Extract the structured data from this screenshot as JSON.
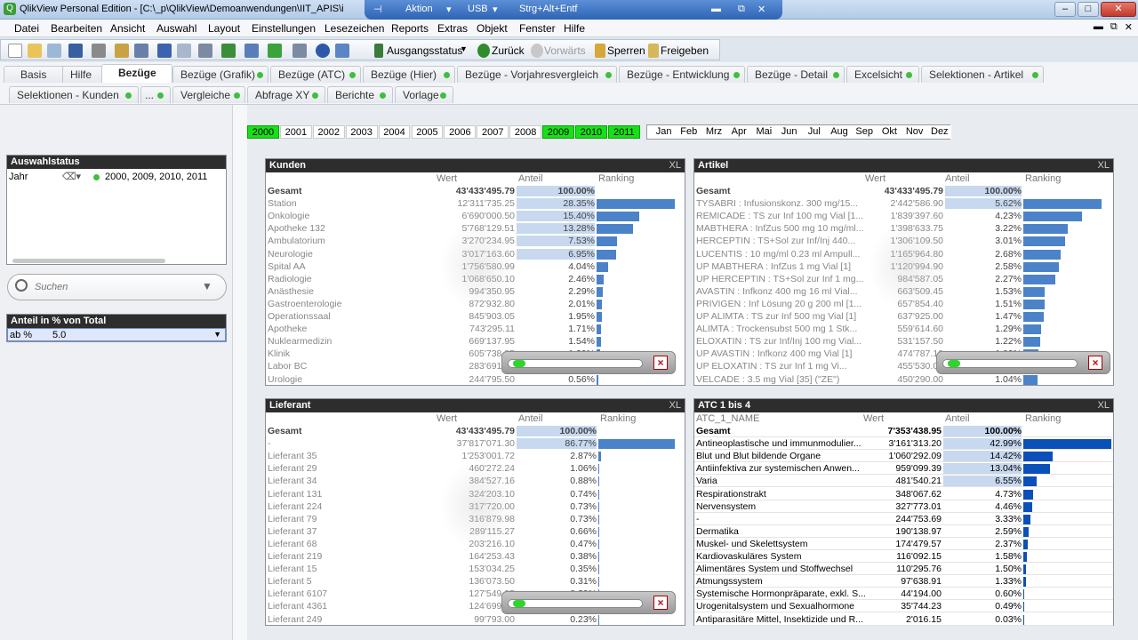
{
  "window": {
    "title": "QlikView Personal Edition - [C:\\_p\\QlikView\\Demoanwendungen\\IIT_APIS\\i"
  },
  "vm_bar": {
    "aktion": "Aktion",
    "usb": "USB",
    "keys": "Strg+Alt+Entf"
  },
  "menu": [
    "Datei",
    "Bearbeiten",
    "Ansicht",
    "Auswahl",
    "Layout",
    "Einstellungen",
    "Lesezeichen",
    "Reports",
    "Extras",
    "Objekt",
    "Fenster",
    "Hilfe"
  ],
  "toolbar": {
    "ausgangsstatus": "Ausgangsstatus",
    "zurueck": "Zurück",
    "vorwaerts": "Vorwärts",
    "sperren": "Sperren",
    "freigeben": "Freigeben"
  },
  "tabs_row1": [
    "Basis",
    "Hilfe",
    "Bezüge",
    "Bezüge (Grafik)",
    "Bezüge (ATC)",
    "Bezüge (Hier)",
    "Bezüge - Vorjahresvergleich",
    "Bezüge - Entwicklung",
    "Bezüge - Detail",
    "Excelsicht",
    "Selektionen - Artikel"
  ],
  "tabs_row2": [
    "Selektionen - Kunden",
    "...",
    "Vergleiche",
    "Abfrage XY",
    "Berichte",
    "Vorlage"
  ],
  "years": [
    "2000",
    "2001",
    "2002",
    "2003",
    "2004",
    "2005",
    "2006",
    "2007",
    "2008",
    "2009",
    "2010",
    "2011"
  ],
  "selected_years": [
    "2000",
    "2009",
    "2010",
    "2011"
  ],
  "months": [
    "Jan",
    "Feb",
    "Mrz",
    "Apr",
    "Mai",
    "Jun",
    "Jul",
    "Aug",
    "Sep",
    "Okt",
    "Nov",
    "Dez"
  ],
  "auswahlstatus": {
    "title": "Auswahlstatus",
    "field": "Jahr",
    "value": "2000, 2009, 2010, 2011"
  },
  "search": {
    "placeholder": "Suchen"
  },
  "anteil": {
    "title": "Anteil in % von Total",
    "label": "ab %",
    "value": "5.0"
  },
  "colors": {
    "accent": "#4b82c8",
    "selected": "#18e018",
    "header": "#2d2d2d"
  },
  "kunden": {
    "title": "Kunden",
    "xl": "XL",
    "headers": {
      "name": "",
      "wert": "Wert",
      "anteil": "Anteil",
      "ranking": "Ranking"
    },
    "total": {
      "name": "Gesamt",
      "wert": "43'433'495.79",
      "anteil": "100.00%"
    },
    "rows": [
      {
        "name": "Station",
        "wert": "12'311'735.25",
        "anteil": "28.35%",
        "r": 28.35,
        "sel": true
      },
      {
        "name": "Onkologie",
        "wert": "6'690'000.50",
        "anteil": "15.40%",
        "r": 15.4,
        "sel": true
      },
      {
        "name": "Apotheke 132",
        "wert": "5'768'129.51",
        "anteil": "13.28%",
        "r": 13.28,
        "sel": true
      },
      {
        "name": "Ambulatorium",
        "wert": "3'270'234.95",
        "anteil": "7.53%",
        "r": 7.53,
        "sel": true
      },
      {
        "name": "Neurologie",
        "wert": "3'017'163.60",
        "anteil": "6.95%",
        "r": 6.95,
        "sel": true
      },
      {
        "name": "Spital AA",
        "wert": "1'756'580.99",
        "anteil": "4.04%",
        "r": 4.04
      },
      {
        "name": "Radiologie",
        "wert": "1'068'650.10",
        "anteil": "2.46%",
        "r": 2.46
      },
      {
        "name": "Anästhesie",
        "wert": "994'350.95",
        "anteil": "2.29%",
        "r": 2.29
      },
      {
        "name": "Gastroenterologie",
        "wert": "872'932.80",
        "anteil": "2.01%",
        "r": 2.01
      },
      {
        "name": "Operationssaal",
        "wert": "845'903.05",
        "anteil": "1.95%",
        "r": 1.95
      },
      {
        "name": "Apotheke",
        "wert": "743'295.11",
        "anteil": "1.71%",
        "r": 1.71
      },
      {
        "name": "Nuklearmedizin",
        "wert": "669'137.95",
        "anteil": "1.54%",
        "r": 1.54
      },
      {
        "name": "Klinik",
        "wert": "605'738.85",
        "anteil": "1.39%",
        "r": 1.39
      },
      {
        "name": "Labor BC",
        "wert": "283'691.23",
        "anteil": "0.65%",
        "r": 0.65
      },
      {
        "name": "Urologie",
        "wert": "244'795.50",
        "anteil": "0.56%",
        "r": 0.56
      }
    ]
  },
  "artikel": {
    "title": "Artikel",
    "xl": "XL",
    "headers": {
      "name": "",
      "wert": "Wert",
      "anteil": "Anteil",
      "ranking": "Ranking"
    },
    "total": {
      "name": "Gesamt",
      "wert": "43'433'495.79",
      "anteil": "100.00%"
    },
    "rows": [
      {
        "name": "TYSABRI : Infusionskonz.  300 mg/15...",
        "wert": "2'442'586.90",
        "anteil": "5.62%",
        "r": 5.62,
        "sel": true
      },
      {
        "name": "REMICADE : TS zur Inf 100 mg Vial [1...",
        "wert": "1'839'397.60",
        "anteil": "4.23%",
        "r": 4.23
      },
      {
        "name": "MABTHERA : InfZus 500 mg 10 mg/ml...",
        "wert": "1'398'633.75",
        "anteil": "3.22%",
        "r": 3.22
      },
      {
        "name": "HERCEPTIN : TS+Sol zur Inf/Inj 440...",
        "wert": "1'306'109.50",
        "anteil": "3.01%",
        "r": 3.01
      },
      {
        "name": "LUCENTIS :  10 mg/ml 0.23 ml Ampull...",
        "wert": "1'165'964.80",
        "anteil": "2.68%",
        "r": 2.68
      },
      {
        "name": "UP MABTHERA : InfZus 1 mg Vial [1]",
        "wert": "1'120'994.90",
        "anteil": "2.58%",
        "r": 2.58
      },
      {
        "name": "UP HERCEPTIN : TS+Sol zur Inf 1 mg...",
        "wert": "984'587.05",
        "anteil": "2.27%",
        "r": 2.27
      },
      {
        "name": "AVASTIN :  Infkonz 400 mg 16 ml Vial...",
        "wert": "663'509.45",
        "anteil": "1.53%",
        "r": 1.53
      },
      {
        "name": "PRIVIGEN : Inf Lösung 20 g 200 ml [1...",
        "wert": "657'854.40",
        "anteil": "1.51%",
        "r": 1.51
      },
      {
        "name": "UP ALIMTA : TS zur Inf 500 mg Vial [1]",
        "wert": "637'925.00",
        "anteil": "1.47%",
        "r": 1.47
      },
      {
        "name": "ALIMTA : Trockensubst  500 mg 1 Stk...",
        "wert": "559'614.60",
        "anteil": "1.29%",
        "r": 1.29
      },
      {
        "name": "ELOXATIN : TS zur Inf/Inj 100 mg Vial...",
        "wert": "531'157.50",
        "anteil": "1.22%",
        "r": 1.22
      },
      {
        "name": "UP AVASTIN : Infkonz  400 mg Vial [1]",
        "wert": "474'787.10",
        "anteil": "1.09%",
        "r": 1.09
      },
      {
        "name": "UP ELOXATIN : TS zur Inf 1 mg Vi...",
        "wert": "455'530.00",
        "anteil": "1.05%",
        "r": 1.05
      },
      {
        "name": "VELCADE : 3.5 mg Vial [35] (\"ZE\")",
        "wert": "450'290.00",
        "anteil": "1.04%",
        "r": 1.04
      }
    ]
  },
  "lieferant": {
    "title": "Lieferant",
    "xl": "XL",
    "headers": {
      "name": "",
      "wert": "Wert",
      "anteil": "Anteil",
      "ranking": "Ranking"
    },
    "total": {
      "name": "Gesamt",
      "wert": "43'433'495.79",
      "anteil": "100.00%"
    },
    "rows": [
      {
        "name": "-",
        "wert": "37'817'071.30",
        "anteil": "86.77%",
        "r": 86.77,
        "sel": true
      },
      {
        "name": "Lieferant 35",
        "wert": "1'253'001.72",
        "anteil": "2.87%",
        "r": 2.87
      },
      {
        "name": "Lieferant 29",
        "wert": "460'272.24",
        "anteil": "1.06%",
        "r": 1.06
      },
      {
        "name": "Lieferant 34",
        "wert": "384'527.16",
        "anteil": "0.88%",
        "r": 0.88
      },
      {
        "name": "Lieferant 131",
        "wert": "324'203.10",
        "anteil": "0.74%",
        "r": 0.74
      },
      {
        "name": "Lieferant 224",
        "wert": "317'720.00",
        "anteil": "0.73%",
        "r": 0.73
      },
      {
        "name": "Lieferant 79",
        "wert": "316'879.98",
        "anteil": "0.73%",
        "r": 0.73
      },
      {
        "name": "Lieferant 37",
        "wert": "289'115.27",
        "anteil": "0.66%",
        "r": 0.66
      },
      {
        "name": "Lieferant 68",
        "wert": "203'216.10",
        "anteil": "0.47%",
        "r": 0.47
      },
      {
        "name": "Lieferant 219",
        "wert": "164'253.43",
        "anteil": "0.38%",
        "r": 0.38
      },
      {
        "name": "Lieferant 15",
        "wert": "153'034.25",
        "anteil": "0.35%",
        "r": 0.35
      },
      {
        "name": "Lieferant 5",
        "wert": "136'073.50",
        "anteil": "0.31%",
        "r": 0.31
      },
      {
        "name": "Lieferant 6107",
        "wert": "127'549.95",
        "anteil": "0.29%",
        "r": 0.29
      },
      {
        "name": "Lieferant 4361",
        "wert": "124'699.50",
        "anteil": "0.29%",
        "r": 0.29
      },
      {
        "name": "Lieferant 249",
        "wert": "99'793.00",
        "anteil": "0.23%",
        "r": 0.23
      }
    ]
  },
  "atc": {
    "title": "ATC 1 bis 4",
    "xl": "XL",
    "headers": {
      "name": "ATC_1_NAME",
      "wert": "Wert",
      "anteil": "Anteil",
      "ranking": "Ranking"
    },
    "total": {
      "name": "Gesamt",
      "wert": "7'353'438.95",
      "anteil": "100.00%"
    },
    "rows": [
      {
        "name": "Antineoplastische und immunmodulier...",
        "wert": "3'161'313.20",
        "anteil": "42.99%",
        "r": 42.99,
        "sel": true
      },
      {
        "name": "Blut und Blut bildende Organe",
        "wert": "1'060'292.09",
        "anteil": "14.42%",
        "r": 14.42,
        "sel": true
      },
      {
        "name": "Antiinfektiva zur systemischen Anwen...",
        "wert": "959'099.39",
        "anteil": "13.04%",
        "r": 13.04,
        "sel": true
      },
      {
        "name": "Varia",
        "wert": "481'540.21",
        "anteil": "6.55%",
        "r": 6.55,
        "sel": true
      },
      {
        "name": "Respirationstrakt",
        "wert": "348'067.62",
        "anteil": "4.73%",
        "r": 4.73
      },
      {
        "name": "Nervensystem",
        "wert": "327'773.01",
        "anteil": "4.46%",
        "r": 4.46
      },
      {
        "name": "-",
        "wert": "244'753.69",
        "anteil": "3.33%",
        "r": 3.33
      },
      {
        "name": "Dermatika",
        "wert": "190'138.97",
        "anteil": "2.59%",
        "r": 2.59
      },
      {
        "name": "Muskel- und Skelettsystem",
        "wert": "174'479.57",
        "anteil": "2.37%",
        "r": 2.37
      },
      {
        "name": "Kardiovaskuläres System",
        "wert": "116'092.15",
        "anteil": "1.58%",
        "r": 1.58
      },
      {
        "name": "Alimentäres System und Stoffwechsel",
        "wert": "110'295.76",
        "anteil": "1.50%",
        "r": 1.5
      },
      {
        "name": "Atmungssystem",
        "wert": "97'638.91",
        "anteil": "1.33%",
        "r": 1.33
      },
      {
        "name": "Systemische Hormonpräparate, exkl. S...",
        "wert": "44'194.00",
        "anteil": "0.60%",
        "r": 0.6
      },
      {
        "name": "Urogenitalsystem und Sexualhormone",
        "wert": "35'744.23",
        "anteil": "0.49%",
        "r": 0.49
      },
      {
        "name": "Antiparasitäre Mittel, Insektizide und R...",
        "wert": "2'016.15",
        "anteil": "0.03%",
        "r": 0.03
      }
    ]
  }
}
